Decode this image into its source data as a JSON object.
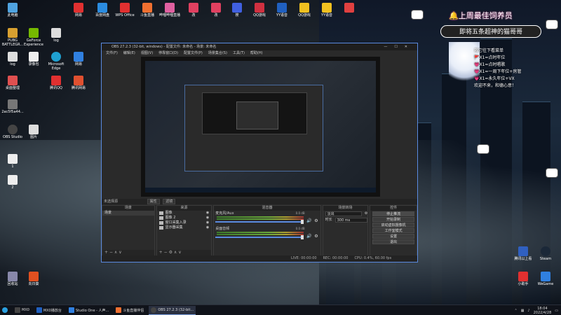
{
  "desktop": {
    "icons": [
      {
        "label": "此电脑",
        "color": "#4fa3e0"
      },
      {
        "label": "PUBG BATTLEGR...",
        "color": "#d8a030"
      },
      {
        "label": "log",
        "color": "#ddd"
      },
      {
        "label": "2ac5f5a44...",
        "color": "#777"
      },
      {
        "label": "OBS Studio",
        "color": "#444"
      },
      {
        "label": "1",
        "color": "#eee"
      },
      {
        "label": "2",
        "color": "#eee"
      },
      {
        "label": "桌面整理",
        "color": "#e05050"
      },
      {
        "label": "回收站",
        "color": "#88a"
      },
      {
        "label": "GeForce Experience",
        "color": "#76b900"
      },
      {
        "label": "录像包",
        "color": "#eee"
      },
      {
        "label": "log",
        "color": "#ddd"
      },
      {
        "label": "图片",
        "color": "#ddd"
      },
      {
        "label": "腾讯QQ",
        "color": "#e03030"
      },
      {
        "label": "向日葵",
        "color": "#e05020"
      },
      {
        "label": "网易",
        "color": "#3080e0"
      },
      {
        "label": "Microsoft Edge",
        "color": "#1fa0d0"
      },
      {
        "label": "腾讯网易",
        "color": "#e05030"
      },
      {
        "label": "WPS Office",
        "color": "#e03030"
      },
      {
        "label": "斗鱼直播",
        "color": "#f07030"
      },
      {
        "label": "改",
        "color": "#e04060"
      },
      {
        "label": "改",
        "color": "#e04060"
      },
      {
        "label": "搜",
        "color": "#4060e0"
      },
      {
        "label": "QQ游戏",
        "color": "#f0c020"
      },
      {
        "label": "YY语音",
        "color": "#f0c020"
      }
    ],
    "top_labels": [
      "网易",
      "百度网盘",
      "WPS Office",
      "斗鱼直播",
      "哔哩哔哩直播",
      "改",
      "改",
      "搜",
      "QQ游戏",
      "YY语音"
    ],
    "right_icons": [
      {
        "label": "腾讯以上看",
        "color": "#3060c0"
      },
      {
        "label": "Steam",
        "color": "#1b2838"
      },
      {
        "label": "小助手",
        "color": "#e03030"
      },
      {
        "label": "WeGame",
        "color": "#3080e0"
      }
    ]
  },
  "overlay": {
    "title": "🔔上周最佳饲养员",
    "banner": "即将五条超神的猫哥哥",
    "list": [
      "救它往下看菜单",
      "🚩X1=点时年位",
      "💗X1=点时唱歌",
      "💗X1=一周下年位+房管",
      "💗X1=永久年位+VX",
      "欢迎不来，和德心意！"
    ]
  },
  "obs": {
    "title": "OBS 27.2.3 (32-bit, windows) - 配置文件: 未命名 - 场景: 未命名",
    "menu": [
      "文件(F)",
      "编辑(E)",
      "视图(V)",
      "停靠窗口(D)",
      "配置文件(P)",
      "场景集合(S)",
      "工具(T)",
      "帮助(H)"
    ],
    "scene_bar": "未选择源",
    "scene_bar_buttons": [
      "属性",
      "滤镜"
    ],
    "docks": {
      "scenes": {
        "header": "场景",
        "items": [
          "场景"
        ]
      },
      "sources": {
        "header": "来源",
        "items": [
          "图像",
          "图像 2",
          "窗口采集入录",
          "显示器采集"
        ]
      },
      "mixer": {
        "header": "混音器",
        "tracks": [
          {
            "name": "麦克风/Aux",
            "db": "0.0 dB"
          },
          {
            "name": "桌面音频",
            "db": "0.0 dB"
          }
        ]
      },
      "transitions": {
        "header": "场景转场",
        "type": "淡出",
        "duration_label": "时长",
        "duration": "300 ms"
      },
      "controls": {
        "header": "控件",
        "buttons": [
          "停止推流",
          "开始录制",
          "启动虚拟摄像机",
          "工作室模式",
          "设置",
          "退出"
        ]
      }
    },
    "status": {
      "live": "LIVE: 00:00:00",
      "rec": "REC: 00:00:00",
      "cpu": "CPU: 0.4%, 60.00 fps"
    }
  },
  "taskbar": {
    "items": [
      {
        "label": "MX0",
        "color": "#444"
      },
      {
        "label": "MX0播放台",
        "color": "#2060c0"
      },
      {
        "label": "Studio One - 人声...",
        "color": "#3080e0"
      },
      {
        "label": "斗鱼直播伴侣",
        "color": "#f07030"
      },
      {
        "label": "OBS 27.2.3 (32-bit...",
        "color": "#444"
      }
    ],
    "time": "18:04",
    "date": "2022/4/28"
  }
}
